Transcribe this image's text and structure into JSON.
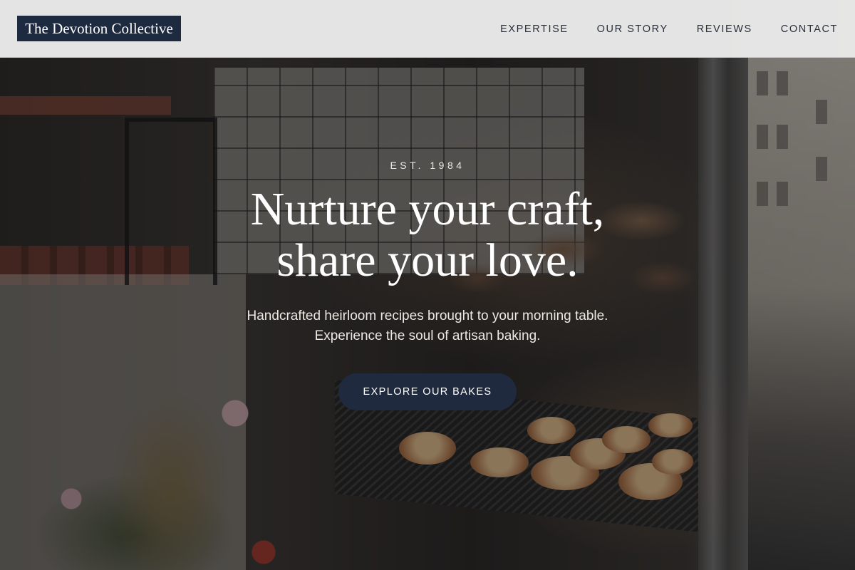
{
  "header": {
    "brand": "The Devotion Collective",
    "nav": [
      {
        "label": "EXPERTISE"
      },
      {
        "label": "OUR STORY"
      },
      {
        "label": "REVIEWS"
      },
      {
        "label": "CONTACT"
      }
    ]
  },
  "hero": {
    "eyebrow": "EST. 1984",
    "headline_line1": "Nurture your craft,",
    "headline_line2": "share your love.",
    "subtext_line1": "Handcrafted heirloom recipes brought to your morning table.",
    "subtext_line2": "Experience the soul of artisan baking.",
    "cta_label": "EXPLORE OUR BAKES",
    "background_image": "bakery-storefront-photo"
  },
  "colors": {
    "brand_navy": "#1e2a40",
    "header_bg": "#ececec",
    "nav_text": "#2a2f3a",
    "hero_text": "#ffffff"
  }
}
